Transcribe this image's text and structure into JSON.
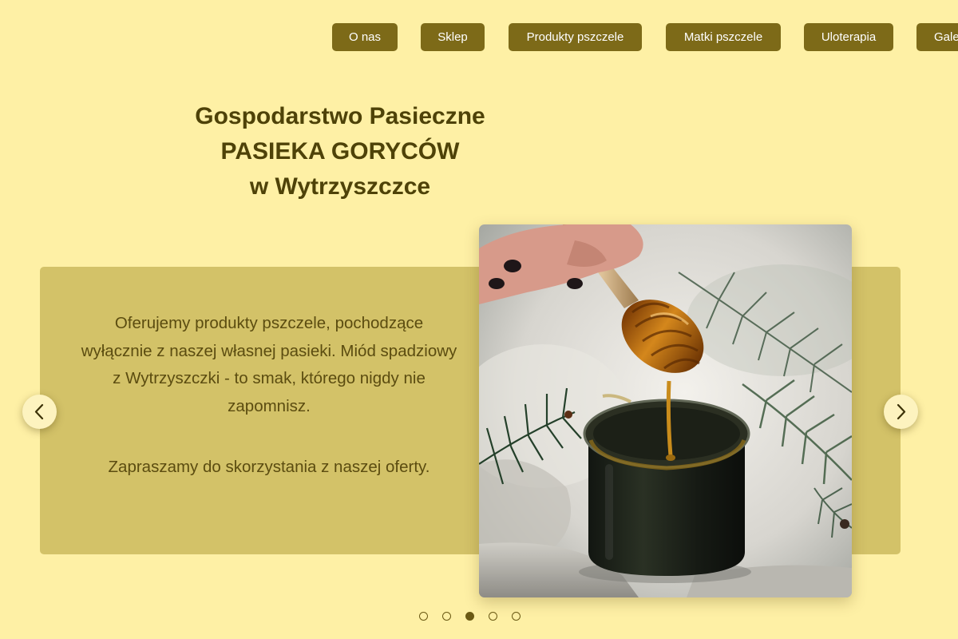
{
  "nav": {
    "items": [
      {
        "label": "O nas"
      },
      {
        "label": "Sklep"
      },
      {
        "label": "Produkty pszczele"
      },
      {
        "label": "Matki pszczele"
      },
      {
        "label": "Uloterapia"
      },
      {
        "label": "Galeria"
      }
    ]
  },
  "hero": {
    "title_line1": "Gospodarstwo Pasieczne",
    "title_line2": "PASIEKA GORYCÓW",
    "title_line3": "w Wytrzyszczce"
  },
  "slide": {
    "paragraph1": "Oferujemy produkty pszczele, pochodzące wyłącznie z naszej własnej pasieki. Miód spadziowy z Wytrzyszczki - to smak, którego nigdy nie zapomnisz.",
    "paragraph2": "Zapraszamy do skorzystania z naszej oferty.",
    "image_subject": "honey-jar-with-dipper"
  },
  "carousel": {
    "slide_count": 5,
    "active_index": 2
  },
  "colors": {
    "page_background": "#fef0a5",
    "nav_button": "#7d6a18",
    "heading_text": "#4e4208",
    "panel_background": "#d3c268",
    "arrow_background": "#fdf3bf"
  }
}
